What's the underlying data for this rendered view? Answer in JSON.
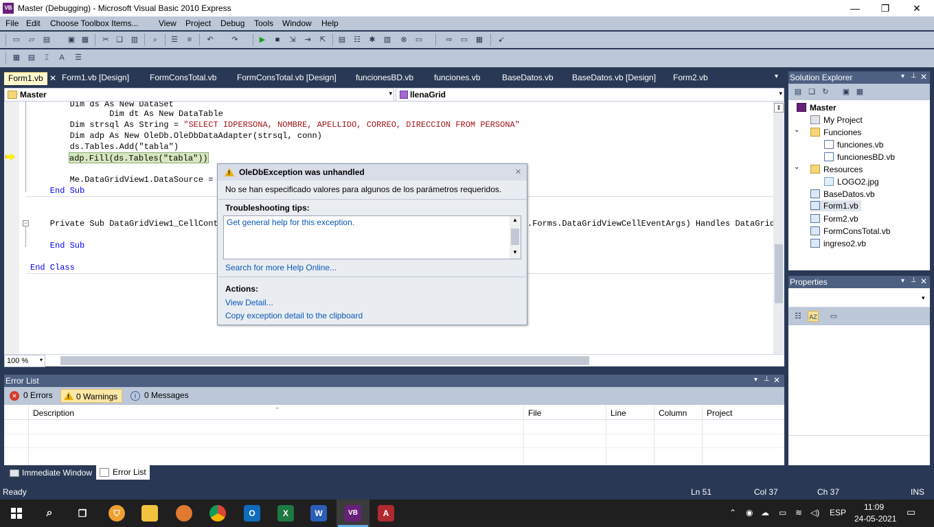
{
  "window": {
    "title": "Master (Debugging) - Microsoft Visual Basic 2010 Express",
    "app_icon": "VB",
    "minimize": "—",
    "maximize": "❐",
    "close": "✕"
  },
  "menu": [
    "File",
    "Edit",
    "Choose Toolbox Items...",
    "View",
    "Project",
    "Debug",
    "Tools",
    "Window",
    "Help"
  ],
  "tabs": [
    {
      "label": "Form1.vb",
      "active": true
    },
    {
      "label": "Form1.vb [Design]"
    },
    {
      "label": "FormConsTotal.vb"
    },
    {
      "label": "FormConsTotal.vb [Design]"
    },
    {
      "label": "funcionesBD.vb"
    },
    {
      "label": "funciones.vb"
    },
    {
      "label": "BaseDatos.vb"
    },
    {
      "label": "BaseDatos.vb [Design]"
    },
    {
      "label": "Form2.vb"
    }
  ],
  "tab_close": "✕",
  "tab_overflow": "▾",
  "navbar": {
    "left": "Master",
    "right": "llenaGrid",
    "drop": "▾"
  },
  "code": {
    "l1": "        Dim ds As New DataSet",
    "l2": "        Dim dt As New DataTable",
    "l3a": "        Dim strsql As String = ",
    "l3b": "\"SELECT IDPERSONA, NOMBRE, APELLIDO, CORREO, DIRECCION FROM PERSONA\"",
    "l4": "        Dim adp As New OleDb.OleDbDataAdapter(strsql, conn)",
    "l5": "        ds.Tables.Add(\"tabla\")",
    "l6": "adp.Fill(ds.Tables(\"tabla\"))",
    "l7": "        Me.DataGridView1.DataSource = d",
    "l8": "    End Sub",
    "l9a": "    Private Sub DataGridView1_CellConte",
    "l9b": ".Forms.DataGridViewCellEventArgs) Handles DataGridVi",
    "l10": "    End Sub",
    "l11": "End Class"
  },
  "zoom": "100 %",
  "exception": {
    "title": "OleDbException was unhandled",
    "message": "No se han especificado valores para algunos de los parámetros requeridos.",
    "tips_header": "Troubleshooting tips:",
    "tip_link": "Get general help for this exception.",
    "search_link": "Search for more Help Online...",
    "actions_header": "Actions:",
    "view_detail": "View Detail...",
    "copy_detail": "Copy exception detail to the clipboard",
    "close": "✕"
  },
  "solution_explorer": {
    "title": "Solution Explorer",
    "items": [
      {
        "label": "Master",
        "level": 0,
        "icon": "project-icon",
        "bold": true
      },
      {
        "label": "My Project",
        "level": 1,
        "icon": "my-project-icon"
      },
      {
        "label": "Funciones",
        "level": 1,
        "icon": "folder-icon",
        "expander": "⌄"
      },
      {
        "label": "funciones.vb",
        "level": 2,
        "icon": "vb-file-icon"
      },
      {
        "label": "funcionesBD.vb",
        "level": 2,
        "icon": "vb-file-icon"
      },
      {
        "label": "Resources",
        "level": 1,
        "icon": "folder-icon",
        "expander": "⌄"
      },
      {
        "label": "LOGO2.jpg",
        "level": 2,
        "icon": "image-file-icon"
      },
      {
        "label": "BaseDatos.vb",
        "level": 1,
        "icon": "form-file-icon"
      },
      {
        "label": "Form1.vb",
        "level": 1,
        "icon": "form-file-icon",
        "selected": true
      },
      {
        "label": "Form2.vb",
        "level": 1,
        "icon": "form-file-icon"
      },
      {
        "label": "FormConsTotal.vb",
        "level": 1,
        "icon": "form-file-icon"
      },
      {
        "label": "ingreso2.vb",
        "level": 1,
        "icon": "form-file-icon"
      }
    ]
  },
  "properties": {
    "title": "Properties"
  },
  "panel_controls": {
    "dropdown": "▾",
    "pin": "📌",
    "close": "✕"
  },
  "error_list": {
    "title": "Error List",
    "errors": "0 Errors",
    "warnings": "0 Warnings",
    "messages": "0 Messages",
    "columns": [
      "Description",
      "File",
      "Line",
      "Column",
      "Project"
    ]
  },
  "bottom_tabs": {
    "immediate": "Immediate Window",
    "errorlist": "Error List"
  },
  "status": {
    "ready": "Ready",
    "ln": "Ln 51",
    "col": "Col 37",
    "ch": "Ch 37",
    "ins": "INS"
  },
  "taskbar": {
    "time": "11:09",
    "date": "24-05-2021",
    "lang": "ESP"
  }
}
